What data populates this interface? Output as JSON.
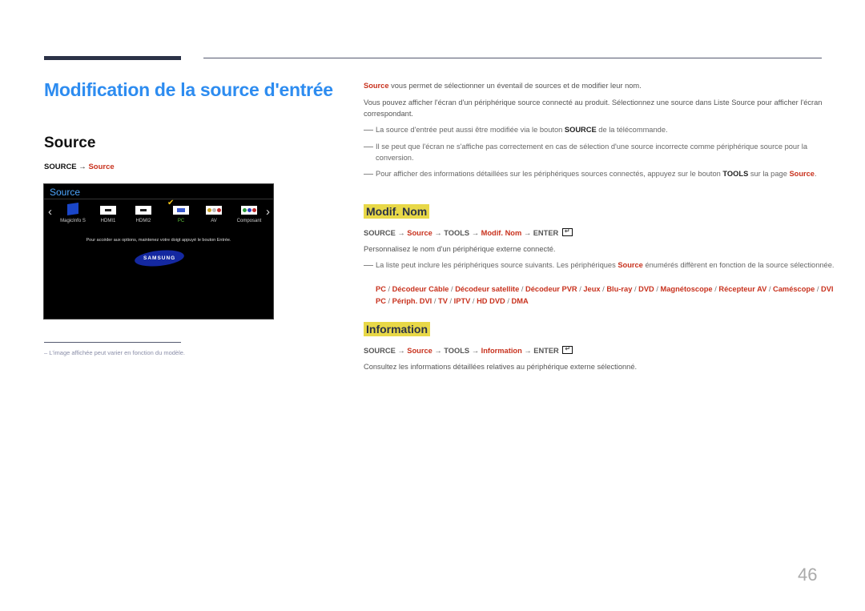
{
  "page": {
    "title": "Modification de la source d'entrée",
    "page_number": "46"
  },
  "left": {
    "heading": "Source",
    "path": {
      "root": "SOURCE",
      "arrow": "→",
      "item": "Source"
    },
    "screen": {
      "title": "Source",
      "sources": [
        {
          "label": "MagicInfo S",
          "icon": "magicinfo-icon"
        },
        {
          "label": "HDMI1",
          "icon": "hdmi-icon"
        },
        {
          "label": "HDMI2",
          "icon": "hdmi-icon"
        },
        {
          "label": "PC",
          "icon": "pc-icon",
          "selected": true
        },
        {
          "label": "AV",
          "icon": "av-icon"
        },
        {
          "label": "Composant",
          "icon": "component-icon"
        }
      ],
      "hint": "Pour accéder aux options, maintenez votre doigt appuyé le bouton Entrée.",
      "logo": "SAMSUNG",
      "prev_arrow": "‹",
      "next_arrow": "›",
      "check": "✔"
    },
    "footnote": "L'image affichée peut varier en fonction du modèle."
  },
  "right": {
    "intro": {
      "lead": "Source",
      "text": " vous permet de sélectionner un éventail de sources et de modifier leur nom."
    },
    "para2": "Vous pouvez afficher l'écran d'un périphérique source connecté au produit. Sélectionnez une source dans Liste Source pour afficher l'écran correspondant.",
    "note1": {
      "pre": "La source d'entrée peut aussi être modifiée via le bouton ",
      "bold": "SOURCE",
      "post": " de la télécommande."
    },
    "note2": "Il se peut que l'écran ne s'affiche pas correctement en cas de sélection d'une source incorrecte comme périphérique source pour la conversion.",
    "note3": {
      "pre": "Pour afficher des informations détaillées sur les périphériques sources connectés, appuyez sur le bouton ",
      "bold": "TOOLS",
      "mid": " sur la page ",
      "red": "Source",
      "post": "."
    },
    "modif": {
      "heading": "Modif. Nom",
      "path": [
        "SOURCE",
        "Source",
        "TOOLS",
        "Modif. Nom",
        "ENTER"
      ],
      "desc": "Personnalisez le nom d'un périphérique externe connecté.",
      "note": {
        "pre": "La liste peut inclure les périphériques source suivants. Les périphériques ",
        "red": "Source",
        "post": " énumérés diffèrent en fonction de la source sélectionnée."
      },
      "devices": [
        "PC",
        "Décodeur Câble",
        "Décodeur satellite",
        "Décodeur PVR",
        "Jeux",
        "Blu-ray",
        "DVD",
        "Magnétoscope",
        "Récepteur AV",
        "Caméscope",
        "DVI PC",
        "Périph. DVI",
        "TV",
        "IPTV",
        "HD DVD",
        "DMA"
      ]
    },
    "information": {
      "heading": "Information",
      "path": [
        "SOURCE",
        "Source",
        "TOOLS",
        "Information",
        "ENTER"
      ],
      "desc": "Consultez les informations détaillées relatives au périphérique externe sélectionné."
    },
    "arrow": "→",
    "separator": " / "
  },
  "colors": {
    "title_blue": "#2d8cf0",
    "accent_red": "#c8321e",
    "highlight_yellow": "#e8d848"
  }
}
